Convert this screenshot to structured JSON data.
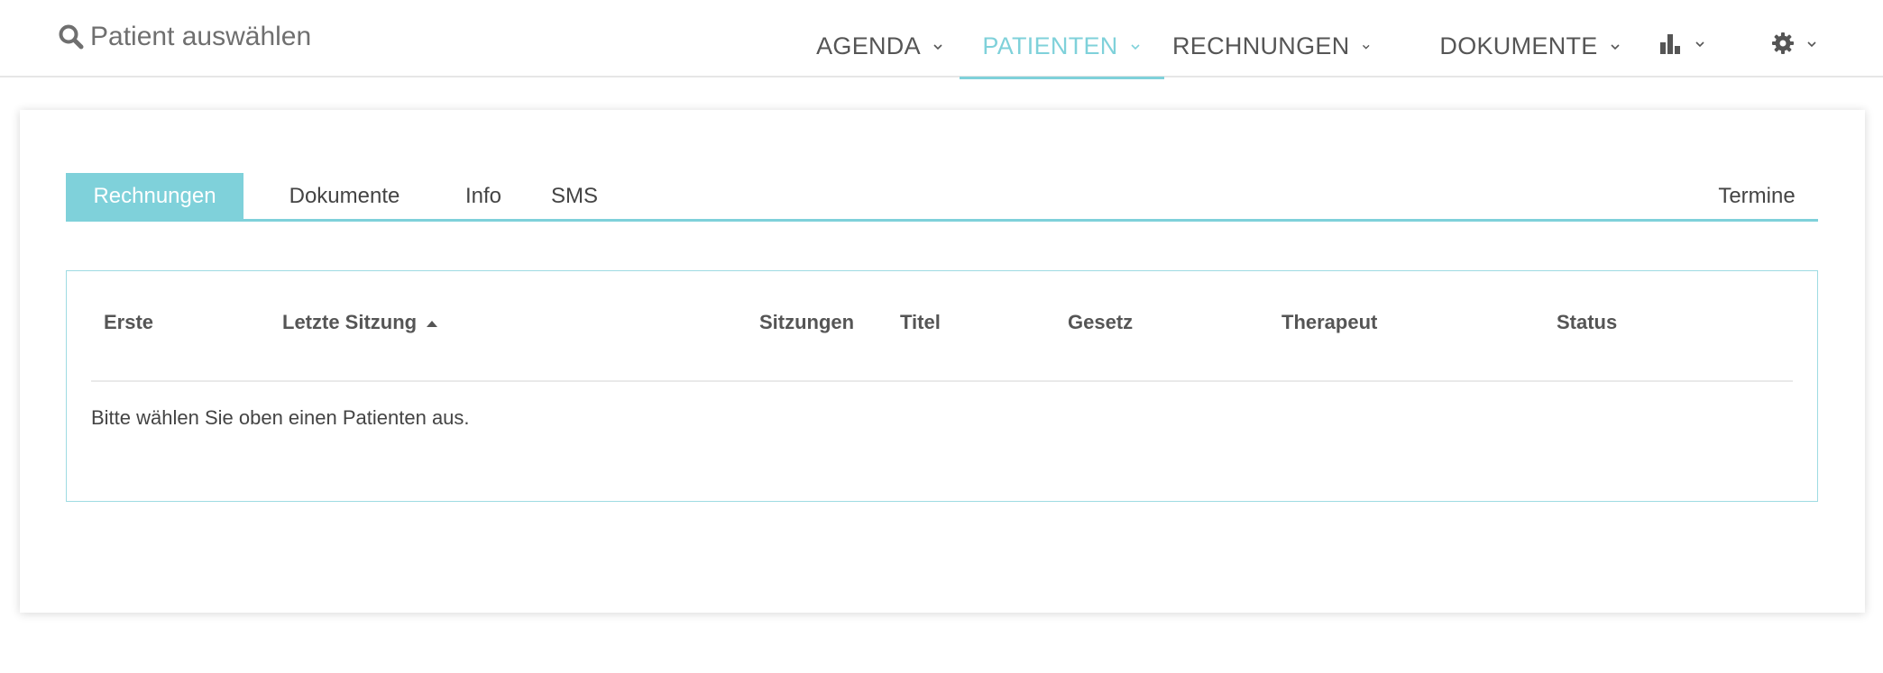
{
  "navbar": {
    "patient_search": {
      "label": "Patient auswählen",
      "icon": "search-icon"
    },
    "items": [
      {
        "label": "AGENDA",
        "active": false
      },
      {
        "label": "PATIENTEN",
        "active": true
      },
      {
        "label": "RECHNUNGEN",
        "active": false
      },
      {
        "label": "DOKUMENTE",
        "active": false
      }
    ],
    "stats_icon": "bar-chart-icon",
    "settings_icon": "gear-icon"
  },
  "tabs": {
    "items": [
      {
        "label": "Rechnungen",
        "active": true
      },
      {
        "label": "Dokumente",
        "active": false
      },
      {
        "label": "Info",
        "active": false
      },
      {
        "label": "SMS",
        "active": false
      }
    ],
    "right_item": {
      "label": "Termine"
    }
  },
  "table": {
    "columns": [
      {
        "label": "Erste"
      },
      {
        "label": "Letzte Sitzung",
        "sort": "ascending"
      },
      {
        "label": "Sitzungen"
      },
      {
        "label": "Titel"
      },
      {
        "label": "Gesetz"
      },
      {
        "label": "Therapeut"
      },
      {
        "label": "Status"
      }
    ],
    "empty_message": "Bitte wählen Sie oben einen Patienten aus."
  },
  "colors": {
    "accent": "#7fd1da",
    "text": "#555555",
    "table_border": "#9edbe2"
  }
}
